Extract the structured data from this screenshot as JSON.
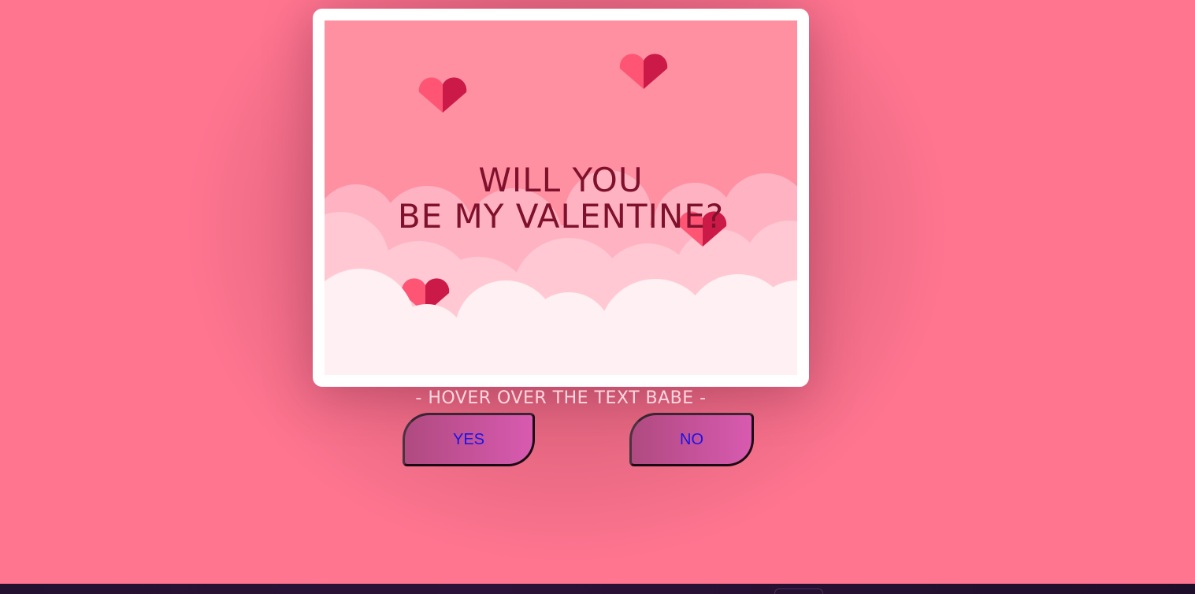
{
  "card": {
    "question_line1": "WILL YOU",
    "question_line2": "BE MY VALENTINE?"
  },
  "hint": "- HOVER OVER THE TEXT BABE -",
  "buttons": {
    "yes_label": "YES",
    "no_label": "NO"
  },
  "colors": {
    "page_background": "#ff7590",
    "scene_sky": "#ff90a2",
    "question_text": "#80112d",
    "hint_text": "#ffd6de",
    "button_text": "#1a12e8",
    "heart_light": "#ff5575",
    "heart_dark": "#cc1a48"
  },
  "icons": [
    "heart-icon",
    "cloud-layer"
  ]
}
